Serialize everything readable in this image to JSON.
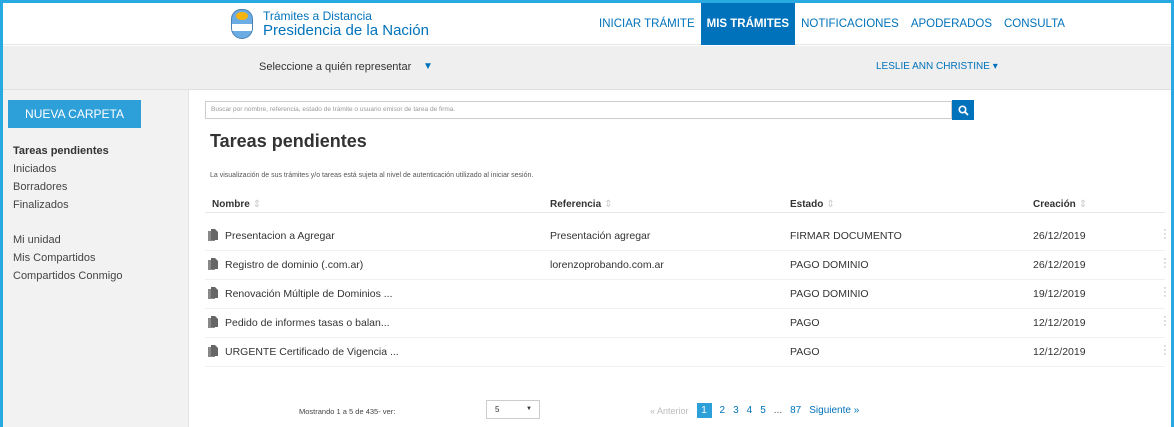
{
  "brand": {
    "top": "Trámites a Distancia",
    "main": "Presidencia de la Nación"
  },
  "nav": {
    "items": [
      {
        "label": "INICIAR TRÁMITE",
        "active": false
      },
      {
        "label": "MIS TRÁMITES",
        "active": true
      },
      {
        "label": "NOTIFICACIONES",
        "active": false
      },
      {
        "label": "APODERADOS",
        "active": false
      },
      {
        "label": "CONSULTA",
        "active": false
      }
    ]
  },
  "represent": {
    "label": "Seleccione a quién representar",
    "caret": "▼"
  },
  "user": {
    "name": "LESLIE ANN CHRISTINE ▾"
  },
  "sidebar": {
    "new_folder": "NUEVA CARPETA",
    "items": [
      {
        "label": "Tareas pendientes",
        "active": true
      },
      {
        "label": "Iniciados",
        "active": false
      },
      {
        "label": "Borradores",
        "active": false
      },
      {
        "label": "Finalizados",
        "active": false
      },
      {
        "label": "Mi unidad",
        "active": false
      },
      {
        "label": "Mis Compartidos",
        "active": false
      },
      {
        "label": "Compartidos Conmigo",
        "active": false
      }
    ]
  },
  "search": {
    "placeholder": "Buscar por nombre, referencia, estado de trámite o usuario emisor de tarea de firma."
  },
  "main": {
    "title": "Tareas pendientes",
    "notice": "La visualización de sus trámites y/o tareas está sujeta al nivel de autenticación utilizado al iniciar sesión."
  },
  "table": {
    "headers": [
      "Nombre",
      "Referencia",
      "Estado",
      "Creación"
    ],
    "sort_icon": "⇕",
    "rows": [
      {
        "nombre": "Presentacion a Agregar",
        "referencia": "Presentación agregar",
        "estado": "FIRMAR DOCUMENTO",
        "creacion": "26/12/2019"
      },
      {
        "nombre": "Registro de dominio (.com.ar)",
        "referencia": "lorenzoprobando.com.ar",
        "estado": "PAGO DOMINIO",
        "creacion": "26/12/2019"
      },
      {
        "nombre": "Renovación Múltiple de Dominios ...",
        "referencia": "",
        "estado": "PAGO DOMINIO",
        "creacion": "19/12/2019"
      },
      {
        "nombre": "Pedido de informes tasas o balan...",
        "referencia": "",
        "estado": "PAGO",
        "creacion": "12/12/2019"
      },
      {
        "nombre": "URGENTE Certificado de Vigencia ...",
        "referencia": "",
        "estado": "PAGO",
        "creacion": "12/12/2019"
      }
    ]
  },
  "footer": {
    "showing": "Mostrando 1 a 5 de 435- ver:",
    "page_size": "5",
    "prev": "« Anterior",
    "pages": [
      "1",
      "2",
      "3",
      "4",
      "5",
      "...",
      "87"
    ],
    "current_page": "1",
    "next": "Siguiente »"
  },
  "colors": {
    "accent": "#0072bb",
    "button": "#2d9fd9",
    "frame": "#29a9e1"
  }
}
